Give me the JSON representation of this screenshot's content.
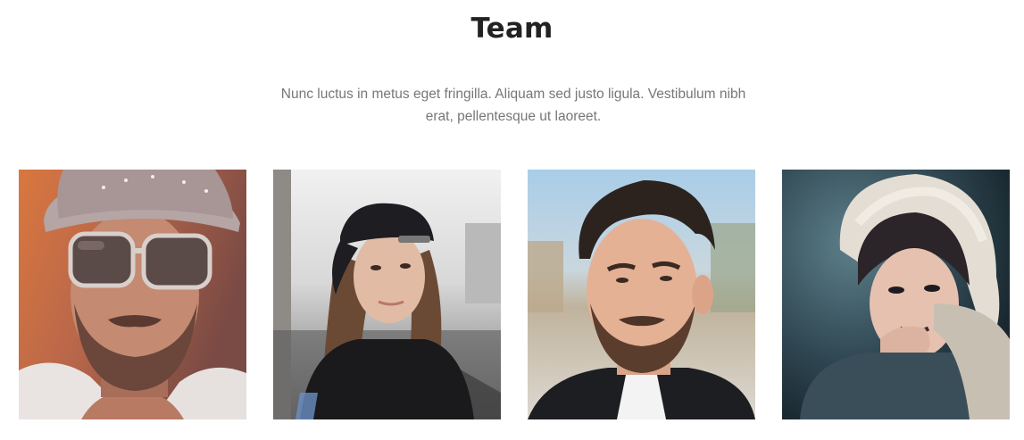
{
  "team": {
    "title": "Team",
    "description": "Nunc luctus in metus eget fringilla. Aliquam sed justo ligula. Vestibulum nibh erat, pellentesque ut laoreet.",
    "members": [
      {
        "photo": "man-with-cap-and-sunglasses-photo"
      },
      {
        "photo": "woman-with-black-cap-photo"
      },
      {
        "photo": "man-with-styled-hair-photo"
      },
      {
        "photo": "woman-with-fur-hood-photo"
      }
    ]
  }
}
